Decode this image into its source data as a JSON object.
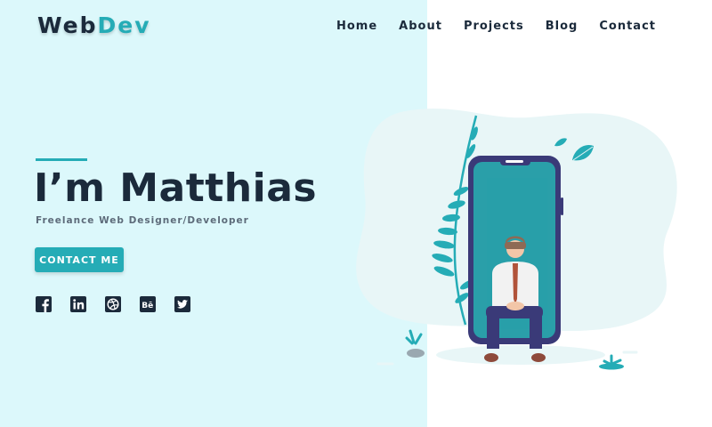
{
  "brand": {
    "part1": "Web",
    "part2": "Dev"
  },
  "nav": {
    "items": [
      "Home",
      "About",
      "Projects",
      "Blog",
      "Contact"
    ]
  },
  "hero": {
    "title": "I’m Matthias",
    "subtitle": "Freelance Web Designer/Developer",
    "cta_label": "CONTACT ME"
  },
  "socials": [
    "facebook-icon",
    "linkedin-icon",
    "dribbble-icon",
    "behance-icon",
    "twitter-icon"
  ],
  "colors": {
    "accent": "#25acb6",
    "dark": "#1b2a3b",
    "left_panel_bg": "#dcf8fb",
    "phone_frame": "#3a3a78",
    "blob": "#e8f6f7"
  },
  "illustration": {
    "subject": "man-sitting-in-smartphone"
  }
}
